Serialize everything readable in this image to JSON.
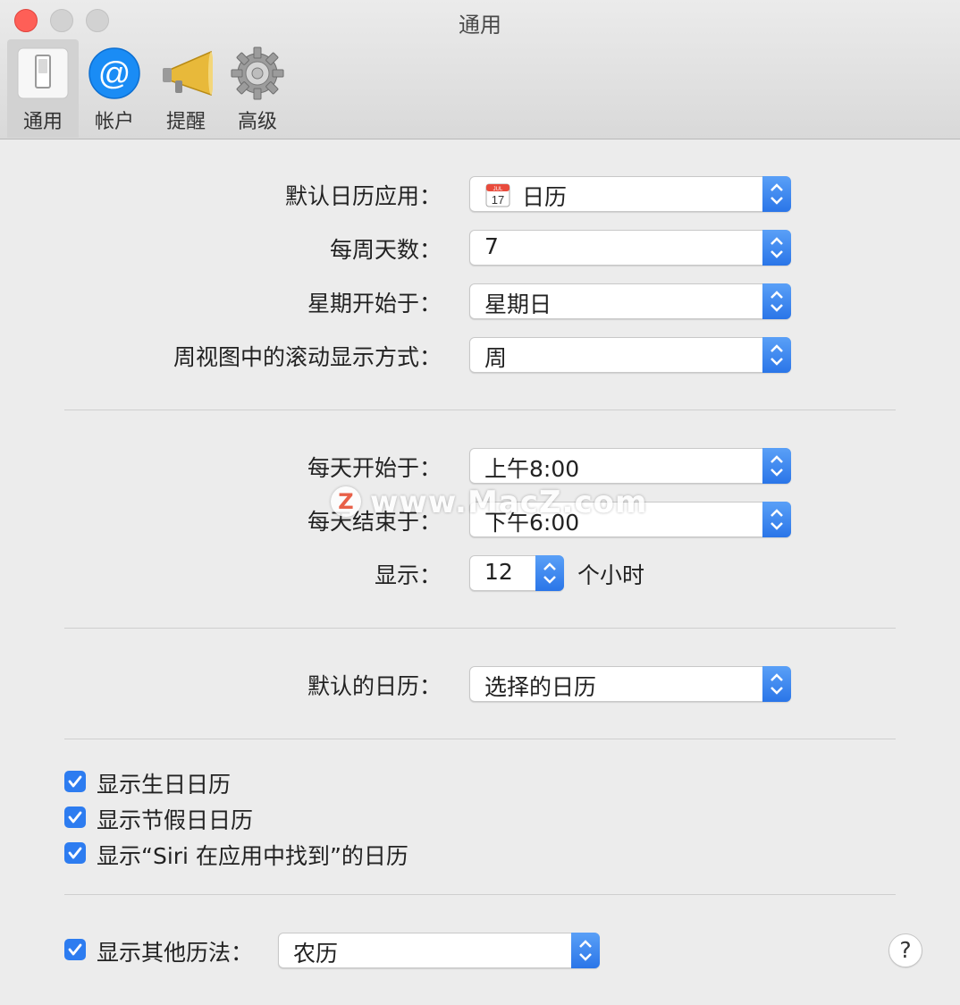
{
  "window": {
    "title": "通用"
  },
  "toolbar": {
    "items": [
      {
        "label": "通用",
        "icon": "switch-icon",
        "selected": true
      },
      {
        "label": "帐户",
        "icon": "at-sign-icon",
        "selected": false
      },
      {
        "label": "提醒",
        "icon": "megaphone-icon",
        "selected": false
      },
      {
        "label": "高级",
        "icon": "gear-icon",
        "selected": false
      }
    ]
  },
  "settings": {
    "default_calendar_app": {
      "label": "默认日历应用：",
      "value": "日历",
      "icon": "calendar-app-icon",
      "icon_month": "JUL",
      "icon_day": "17"
    },
    "days_per_week": {
      "label": "每周天数：",
      "value": "7"
    },
    "week_start": {
      "label": "星期开始于：",
      "value": "星期日"
    },
    "week_scroll": {
      "label": "周视图中的滚动显示方式：",
      "value": "周"
    },
    "day_start": {
      "label": "每天开始于：",
      "value": "上午8:00"
    },
    "day_end": {
      "label": "每天结束于：",
      "value": "下午6:00"
    },
    "show_hours": {
      "label": "显示：",
      "value": "12",
      "unit": "个小时"
    },
    "default_calendar": {
      "label": "默认的日历：",
      "value": "选择的日历"
    }
  },
  "checkboxes": [
    {
      "label": "显示生日日历",
      "checked": true
    },
    {
      "label": "显示节假日日历",
      "checked": true
    },
    {
      "label": "显示“Siri 在应用中找到”的日历",
      "checked": true
    }
  ],
  "other_calendar": {
    "label": "显示其他历法：",
    "checked": true,
    "value": "农历"
  },
  "help_button": {
    "label": "?"
  },
  "watermark": {
    "badge": "Z",
    "text": "www.MacZ.com"
  },
  "colors": {
    "accent": "#2d7cf0",
    "close": "#fe5f57"
  }
}
